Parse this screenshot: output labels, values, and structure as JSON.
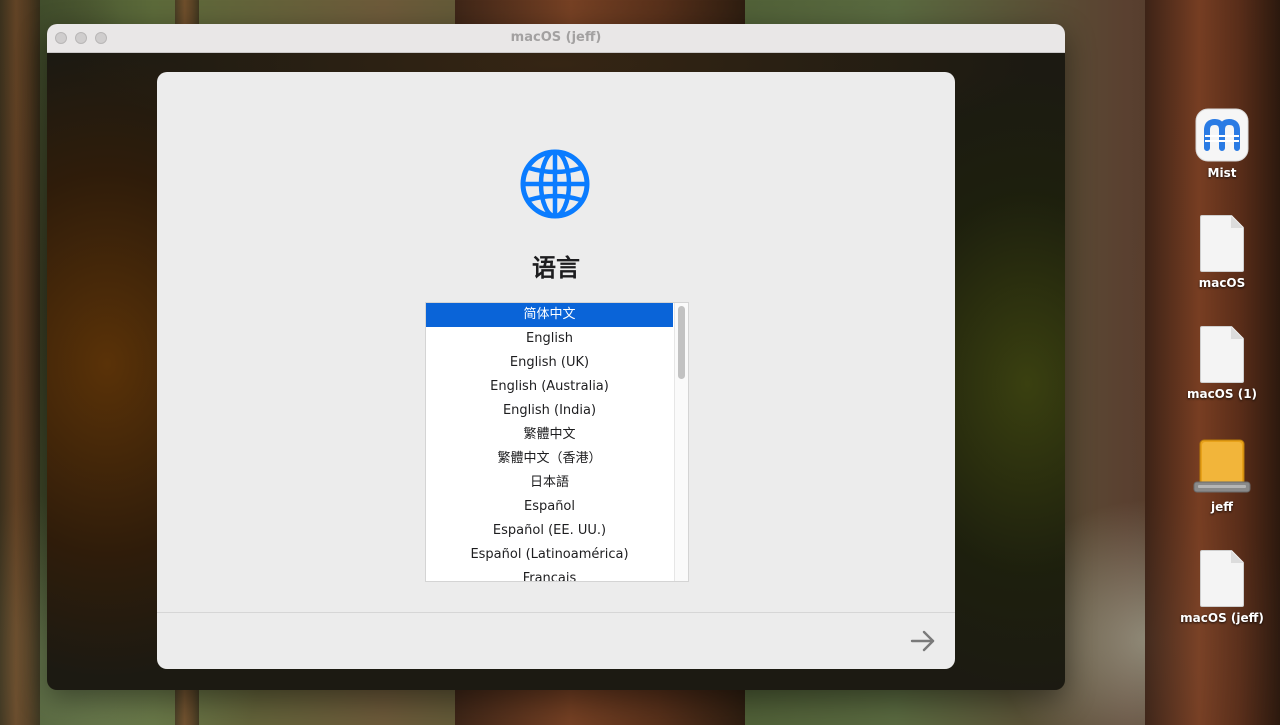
{
  "window": {
    "title": "macOS (jeff)"
  },
  "installer": {
    "heading": "语言",
    "icon": "globe-icon",
    "accent_color": "#0a64d8",
    "languages": [
      "简体中文",
      "English",
      "English (UK)",
      "English (Australia)",
      "English (India)",
      "繁體中文",
      "繁體中文（香港）",
      "日本語",
      "Español",
      "Español (EE. UU.)",
      "Español (Latinoamérica)",
      "Français"
    ],
    "selected_language": "简体中文",
    "next_icon": "arrow-right-icon"
  },
  "desktop_icons": [
    {
      "label": "Mist",
      "icon": "mist-app-icon"
    },
    {
      "label": "macOS",
      "icon": "document-alias-icon"
    },
    {
      "label": "macOS (1)",
      "icon": "document-alias-icon"
    },
    {
      "label": "jeff",
      "icon": "external-drive-icon"
    },
    {
      "label": "macOS (jeff)",
      "icon": "document-alias-icon"
    }
  ]
}
